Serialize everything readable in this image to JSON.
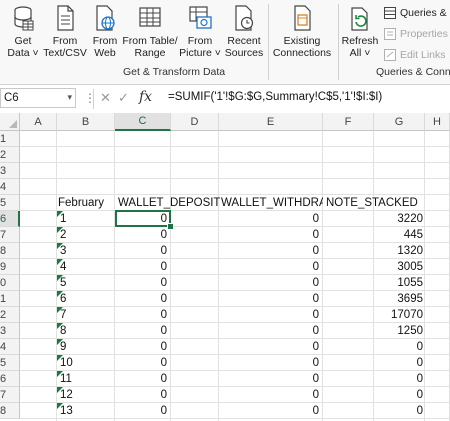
{
  "ribbon": {
    "get_data": "Get\nData ˅",
    "from_text_csv": "From\nText/CSV",
    "from_web": "From\nWeb",
    "from_table_range": "From Table/\nRange",
    "from_picture": "From\nPicture ˅",
    "recent_sources": "Recent\nSources",
    "existing_connections": "Existing\nConnections",
    "refresh_all": "Refresh\nAll ˅",
    "queries_connections": "Queries & C",
    "properties": "Properties",
    "edit_links": "Edit Links",
    "group_get_transform": "Get & Transform Data",
    "group_queries": "Queries & Connec"
  },
  "formula_bar": {
    "name_box": "C6",
    "cancel_symbol": "✕",
    "enter_symbol": "✓",
    "fx_label": "fx",
    "formula": "=SUMIF('1'!$G:$G,Summary!C$5,'1'!$I:$I)"
  },
  "grid": {
    "columns": [
      "A",
      "B",
      "C",
      "D",
      "E",
      "F",
      "G",
      "H"
    ],
    "rows": [
      "1",
      "2",
      "3",
      "4",
      "5",
      "6",
      "7",
      "8",
      "9",
      "0",
      "1",
      "2",
      "3",
      "4",
      "5",
      "6",
      "7",
      "8"
    ],
    "selected_cell": "C6",
    "headers": {
      "month": "February",
      "wallet_deposit": "WALLET_DEPOSIT",
      "wallet_withdraw": "WALLET_WITHDRAW",
      "note_stacked": "NOTE_STACKED"
    },
    "data_rows": [
      {
        "day": "1",
        "deposit": "0",
        "withdraw": "0",
        "stacked": "3220"
      },
      {
        "day": "2",
        "deposit": "0",
        "withdraw": "0",
        "stacked": "445"
      },
      {
        "day": "3",
        "deposit": "0",
        "withdraw": "0",
        "stacked": "1320"
      },
      {
        "day": "4",
        "deposit": "0",
        "withdraw": "0",
        "stacked": "3005"
      },
      {
        "day": "5",
        "deposit": "0",
        "withdraw": "0",
        "stacked": "1055"
      },
      {
        "day": "6",
        "deposit": "0",
        "withdraw": "0",
        "stacked": "3695"
      },
      {
        "day": "7",
        "deposit": "0",
        "withdraw": "0",
        "stacked": "17070"
      },
      {
        "day": "8",
        "deposit": "0",
        "withdraw": "0",
        "stacked": "1250"
      },
      {
        "day": "9",
        "deposit": "0",
        "withdraw": "0",
        "stacked": "0"
      },
      {
        "day": "10",
        "deposit": "0",
        "withdraw": "0",
        "stacked": "0"
      },
      {
        "day": "11",
        "deposit": "0",
        "withdraw": "0",
        "stacked": "0"
      },
      {
        "day": "12",
        "deposit": "0",
        "withdraw": "0",
        "stacked": "0"
      },
      {
        "day": "13",
        "deposit": "0",
        "withdraw": "0",
        "stacked": "0"
      }
    ]
  },
  "colors": {
    "accent": "#217346",
    "error_triangle": "#1e7b34"
  }
}
